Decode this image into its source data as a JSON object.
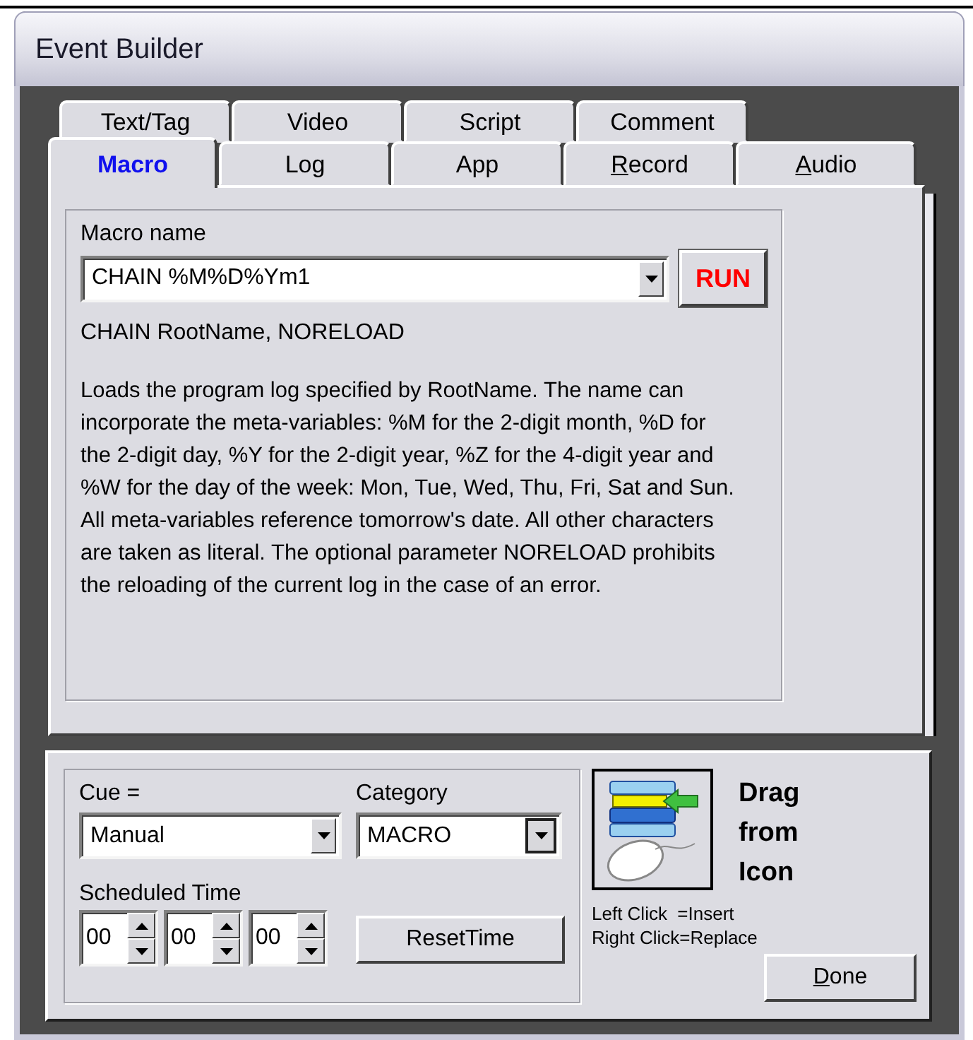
{
  "window": {
    "title": "Event Builder"
  },
  "tabs": {
    "back_row": [
      {
        "label": "Text/Tag",
        "selected": false,
        "underline_first": false
      },
      {
        "label": "Video",
        "selected": false,
        "underline_first": false
      },
      {
        "label": "Script",
        "selected": false,
        "underline_first": false
      },
      {
        "label": "Comment",
        "selected": false,
        "underline_first": false
      }
    ],
    "front_row": [
      {
        "label": "Macro",
        "selected": true,
        "underline_first": false
      },
      {
        "label": "Log",
        "selected": false,
        "underline_first": false
      },
      {
        "label": "App",
        "selected": false,
        "underline_first": false
      },
      {
        "label": "Record",
        "selected": false,
        "underline_first": true
      },
      {
        "label": "Audio",
        "selected": false,
        "underline_first": true
      }
    ]
  },
  "macro": {
    "name_label": "Macro name",
    "name_value": "CHAIN %M%D%Ym1",
    "run_button": "RUN",
    "syntax": "CHAIN RootName, NORELOAD",
    "description": "Loads the program log specified by RootName. The name can incorporate the meta-variables: %M for the 2-digit month, %D for the 2-digit day, %Y for the 2-digit year, %Z for the 4-digit year and %W for the day of the week: Mon, Tue, Wed, Thu, Fri, Sat and Sun. All meta-variables reference tomorrow's date. All other characters are taken as literal. The optional parameter NORELOAD prohibits the reloading of the current log in the case of an error."
  },
  "cue": {
    "label": "Cue =",
    "value": "Manual"
  },
  "category": {
    "label": "Category",
    "value": "MACRO"
  },
  "scheduled_time": {
    "label": "Scheduled Time",
    "fields": [
      "00",
      "00",
      "00"
    ]
  },
  "reset_button": {
    "label": "ResetTime"
  },
  "drag": {
    "title": "Drag from Icon",
    "hints": [
      "Left Click  =Insert",
      "Right Click=Replace"
    ]
  },
  "done_button": {
    "label": "Done",
    "underline_first": true
  }
}
